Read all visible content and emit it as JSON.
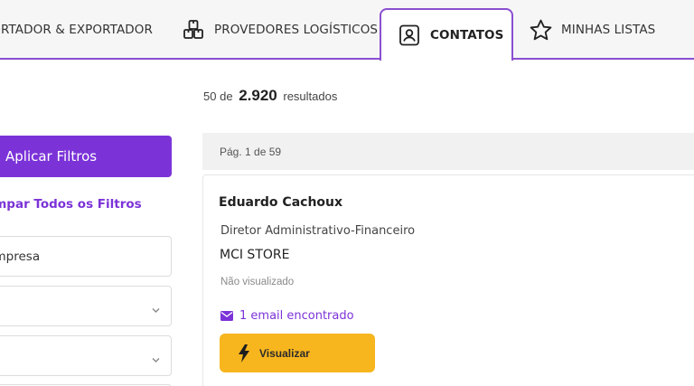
{
  "tabs": [
    {
      "label": "PORTADOR & EXPORTADOR",
      "icon": "ship-icon"
    },
    {
      "label": "PROVEDORES LOGÍSTICOS",
      "icon": "boxes-icon"
    },
    {
      "label": "CONTATOS",
      "icon": "contact-card-icon",
      "active": true
    },
    {
      "label": "MINHAS LISTAS",
      "icon": "star-icon"
    }
  ],
  "sidebar": {
    "apply_button": "Aplicar Filtros",
    "clear_link": "Limpar Todos os Filtros",
    "company_field": "Empresa"
  },
  "results": {
    "shown": "50",
    "connector": "de",
    "total": "2.920",
    "suffix": "resultados",
    "page_label": "Pág. 1 de 59"
  },
  "contact": {
    "name": "Eduardo Cachoux",
    "role": "Diretor Administrativo-Financeiro",
    "company": "MCI STORE",
    "status": "Não visualizado",
    "email_text": "1 email encontrado",
    "view_button": "Visualizar"
  },
  "colors": {
    "accent": "#7b33d8",
    "tab_border": "#8a4fd1",
    "view_button": "#f7b51e"
  }
}
